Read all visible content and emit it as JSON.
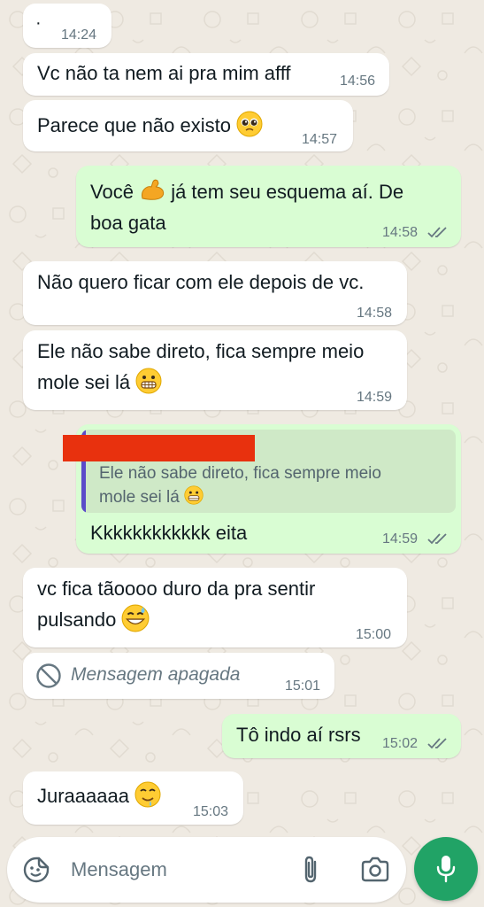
{
  "colors": {
    "incoming_bubble": "#ffffff",
    "outgoing_bubble": "#d9fdd3",
    "background": "#efeae2",
    "read_ticks": "#667781",
    "quote_accent": "#5b4bc9",
    "redaction": "#e8310e",
    "mic_button": "#21a366"
  },
  "messages": [
    {
      "text": "·",
      "time": "14:24"
    },
    {
      "text": "Vc não ta nem ai pra mim afff",
      "time": "14:56"
    },
    {
      "text": "Parece que não existo",
      "emoji": "pleading-face",
      "time": "14:57"
    },
    {
      "line1_pre": "Você",
      "line1_emoji": "flexed-biceps",
      "line1_post": "já tem seu esquema aí. De",
      "line2": "boa gata",
      "time": "14:58"
    },
    {
      "text": "Não quero ficar com ele depois de vc.",
      "time": "14:58"
    },
    {
      "line1": "Ele não sabe direto, fica sempre meio",
      "line2": "mole sei lá",
      "emoji": "grimacing-face",
      "time": "14:59"
    },
    {
      "quote_line1": "Ele não sabe direto, fica sempre meio",
      "quote_line2": "mole sei lá",
      "quote_emoji": "grimacing-face",
      "text": "Kkkkkkkkkkkk eita",
      "time": "14:59"
    },
    {
      "line1": "vc fica tãoooo duro da pra sentir",
      "line2": "pulsando",
      "emoji": "grinning-face-with-sweat",
      "time": "15:00"
    },
    {
      "text": "Mensagem apagada",
      "icon": "deleted-icon",
      "time": "15:01"
    },
    {
      "text": "Tô indo aí rsrs",
      "time": "15:02"
    },
    {
      "text": "Juraaaaaa",
      "emoji": "drooling-face",
      "time": "15:03"
    }
  ],
  "composer": {
    "placeholder": "Mensagem",
    "emoji_icon": "sticker-emoji-icon",
    "attach_icon": "paperclip-icon",
    "camera_icon": "camera-icon",
    "mic_icon": "microphone-icon"
  }
}
